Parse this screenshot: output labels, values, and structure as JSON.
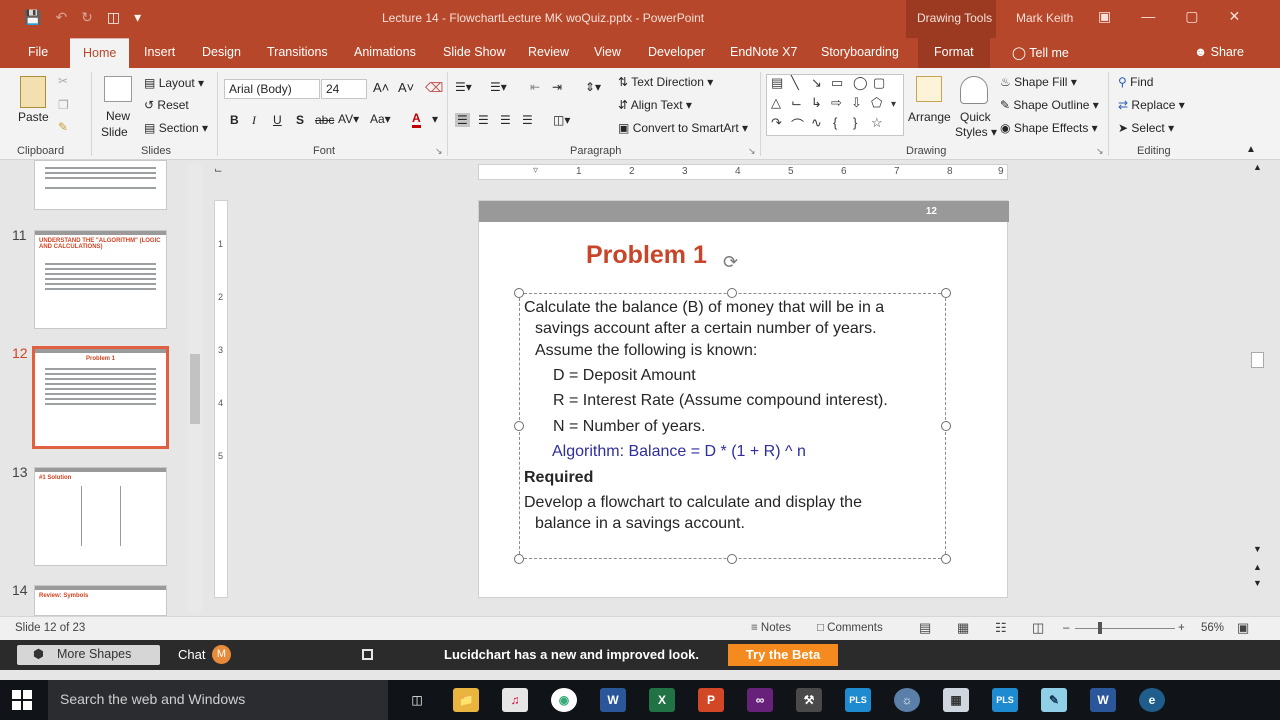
{
  "window": {
    "title": "Lecture 14 - FlowchartLecture MK woQuiz.pptx - PowerPoint",
    "context_tab_group": "Drawing Tools",
    "user": "Mark Keith"
  },
  "tabs": [
    {
      "label": "File"
    },
    {
      "label": "Home"
    },
    {
      "label": "Insert"
    },
    {
      "label": "Design"
    },
    {
      "label": "Transitions"
    },
    {
      "label": "Animations"
    },
    {
      "label": "Slide Show"
    },
    {
      "label": "Review"
    },
    {
      "label": "View"
    },
    {
      "label": "Developer"
    },
    {
      "label": "EndNote X7"
    },
    {
      "label": "Storyboarding"
    },
    {
      "label": "Format"
    }
  ],
  "tell_me": "Tell me",
  "share": "Share",
  "ribbon": {
    "clipboard": {
      "label": "Clipboard",
      "paste": "Paste"
    },
    "slides": {
      "label": "Slides",
      "new_slide": "New",
      "new_slide2": "Slide",
      "layout": "Layout",
      "reset": "Reset",
      "section": "Section"
    },
    "font": {
      "label": "Font",
      "font_name": "Arial (Body)",
      "font_size": "24"
    },
    "paragraph": {
      "label": "Paragraph",
      "text_direction": "Text Direction",
      "align_text": "Align Text",
      "smartart": "Convert to SmartArt"
    },
    "drawing": {
      "label": "Drawing",
      "arrange": "Arrange",
      "quick": "Quick",
      "styles": "Styles",
      "shape_fill": "Shape Fill",
      "shape_outline": "Shape Outline",
      "shape_effects": "Shape Effects"
    },
    "editing": {
      "label": "Editing",
      "find": "Find",
      "replace": "Replace",
      "select": "Select"
    }
  },
  "thumbnails": [
    {
      "num": "11",
      "title": "UNDERSTAND THE \"ALGORITHM\" (LOGIC AND CALCULATIONS)"
    },
    {
      "num": "12",
      "title": "Problem 1"
    },
    {
      "num": "13",
      "title": "#1 Solution"
    },
    {
      "num": "14",
      "title": "Review: Symbols"
    }
  ],
  "ruler": {
    "h": [
      "1",
      "2",
      "3",
      "4",
      "5",
      "6",
      "7",
      "8",
      "9"
    ],
    "v": [
      "1",
      "2",
      "3",
      "4",
      "5"
    ]
  },
  "slide": {
    "number": "12",
    "title": "Problem 1",
    "lines": [
      "Calculate the balance (B) of money that will be in a",
      "savings account after a certain number of years.",
      "Assume the following is known:",
      "D = Deposit Amount",
      "R = Interest Rate (Assume compound interest).",
      "N = Number of years.",
      "Algorithm:  Balance = D * (1 + R) ^ n",
      "Required",
      "Develop a flowchart to calculate and display the",
      "balance in a savings account."
    ]
  },
  "status": {
    "slide_of": "Slide 12 of 23",
    "notes": "Notes",
    "comments": "Comments",
    "zoom": "56%"
  },
  "lucidchart": {
    "more_shapes": "More Shapes",
    "chat": "Chat",
    "chat_badge": "M",
    "message": "Lucidchart has a new and improved look.",
    "beta": "Try the Beta"
  },
  "taskbar": {
    "search": "Search the web and Windows",
    "apps": [
      "word",
      "excel",
      "powerpoint",
      "visual-studio",
      "tools",
      "pls",
      "globe",
      "calculator",
      "pls",
      "notepad",
      "word",
      "ie"
    ]
  },
  "colors": {
    "accent": "#b7472a",
    "title": "#c8452a",
    "algorithm": "#2e2e9e",
    "beta": "#f58b1f"
  }
}
